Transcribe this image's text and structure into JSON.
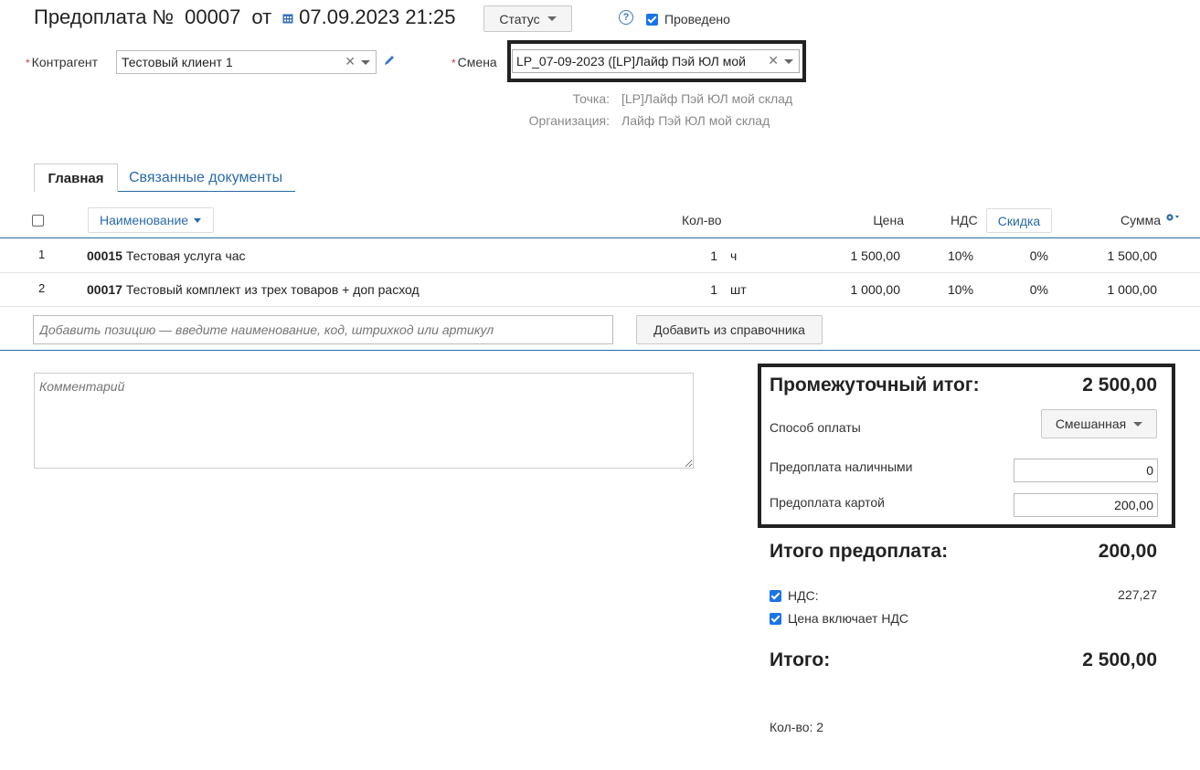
{
  "header": {
    "doc_title": "Предоплата №",
    "doc_number": "00007",
    "date_prefix": "от",
    "date": "07.09.2023 21:25",
    "status_label": "Статус",
    "help_glyph": "?",
    "posted_label": "Проведено",
    "posted_checked": true
  },
  "form": {
    "required_mark": "*",
    "counterparty_label": "Контрагент",
    "counterparty_value": "Тестовый клиент 1",
    "shift_label": "Смена",
    "shift_value": "LP_07-09-2023 ([LP]Лайф Пэй ЮЛ мой",
    "point_label": "Точка:",
    "point_value": "[LP]Лайф Пэй ЮЛ мой склад",
    "org_label": "Организация:",
    "org_value": "Лайф Пэй ЮЛ мой склад"
  },
  "tabs": [
    {
      "label": "Главная",
      "active": true
    },
    {
      "label": "Связанные документы",
      "active": false
    }
  ],
  "table": {
    "headers": {
      "name": "Наименование",
      "qty": "Кол-во",
      "price": "Цена",
      "vat": "НДС",
      "discount": "Скидка",
      "sum": "Сумма"
    },
    "rows": [
      {
        "n": "1",
        "code": "00015",
        "name": "Тестовая услуга час",
        "qty": "1",
        "unit": "ч",
        "price": "1 500,00",
        "vat": "10%",
        "discount": "0%",
        "sum": "1 500,00"
      },
      {
        "n": "2",
        "code": "00017",
        "name": "Тестовый комплект из трех товаров + доп расход",
        "qty": "1",
        "unit": "шт",
        "price": "1 000,00",
        "vat": "10%",
        "discount": "0%",
        "sum": "1 000,00"
      }
    ],
    "add_placeholder": "Добавить позицию — введите наименование, код, штрихкод или артикул",
    "add_from_catalog": "Добавить из справочника"
  },
  "comment": {
    "placeholder": "Комментарий"
  },
  "totals": {
    "subtotal_label": "Промежуточный итог:",
    "subtotal_value": "2 500,00",
    "payment_method_label": "Способ оплаты",
    "payment_method_value": "Смешанная",
    "cash_label": "Предоплата наличными",
    "cash_value": "0",
    "card_label": "Предоплата картой",
    "card_value": "200,00",
    "prepay_total_label": "Итого предоплата:",
    "prepay_total_value": "200,00",
    "vat_label": "НДС:",
    "vat_value": "227,27",
    "vat_checked": true,
    "price_incl_vat_label": "Цена включает НДС",
    "price_incl_vat_checked": true,
    "total_label": "Итого:",
    "total_value": "2 500,00",
    "count_text": "Кол-во: 2"
  },
  "colors": {
    "accent": "#1a73e8",
    "link": "#2a6aa8",
    "frame": "#222222",
    "required": "#dd3333"
  },
  "icons": [
    "calendar-icon",
    "help-icon",
    "clear-icon",
    "dropdown-caret-icon",
    "edit-pencil-icon",
    "gear-icon"
  ]
}
